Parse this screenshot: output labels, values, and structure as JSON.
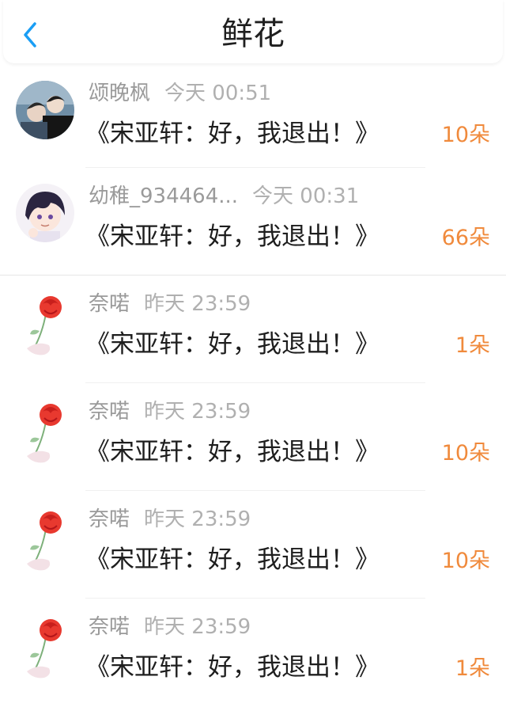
{
  "header": {
    "title": "鲜花"
  },
  "rows": [
    {
      "name": "颂晚枫",
      "time": "今天 00:51",
      "message": "《宋亚轩：好，我退出！》",
      "count": "10朵",
      "avatar": "photo-avatar"
    },
    {
      "name": "幼稚_934464...",
      "time": "今天 00:31",
      "message": "《宋亚轩：好，我退出！》",
      "count": "66朵",
      "avatar": "anime-avatar"
    },
    {
      "name": "奈喏",
      "time": "昨天 23:59",
      "message": "《宋亚轩：好，我退出！》",
      "count": "1朵",
      "avatar": "rose-icon"
    },
    {
      "name": "奈喏",
      "time": "昨天 23:59",
      "message": "《宋亚轩：好，我退出！》",
      "count": "10朵",
      "avatar": "rose-icon"
    },
    {
      "name": "奈喏",
      "time": "昨天 23:59",
      "message": "《宋亚轩：好，我退出！》",
      "count": "10朵",
      "avatar": "rose-icon"
    },
    {
      "name": "奈喏",
      "time": "昨天 23:59",
      "message": "《宋亚轩：好，我退出！》",
      "count": "1朵",
      "avatar": "rose-icon"
    }
  ],
  "colors": {
    "accent": "#1a9ef5",
    "count": "#f08a3c"
  }
}
